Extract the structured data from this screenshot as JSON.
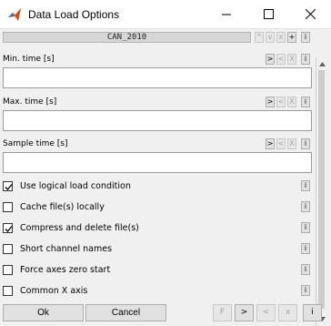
{
  "window": {
    "title": "Data Load Options",
    "controls": {
      "minimize": "minimize",
      "maximize": "maximize",
      "close": "close"
    }
  },
  "header": {
    "name": "CAN_2010",
    "buttons": [
      "^",
      "v",
      "x",
      "+",
      "i"
    ]
  },
  "fields": [
    {
      "label": "Min. time [s]",
      "value": "",
      "buttons": [
        ">",
        "<",
        "X",
        "i"
      ]
    },
    {
      "label": "Max. time [s]",
      "value": "",
      "buttons": [
        ">",
        "<",
        "X",
        "i"
      ]
    },
    {
      "label": "Sample time [s]",
      "value": "",
      "buttons": [
        ">",
        "<",
        "X",
        "i"
      ]
    }
  ],
  "checkboxes": [
    {
      "label": "Use logical load condition",
      "checked": true,
      "info": "i"
    },
    {
      "label": "Cache file(s) locally",
      "checked": false,
      "info": "i"
    },
    {
      "label": "Compress and delete file(s)",
      "checked": true,
      "info": "i"
    },
    {
      "label": "Short channel names",
      "checked": false,
      "info": "i"
    },
    {
      "label": "Force axes zero start",
      "checked": false,
      "info": "i"
    },
    {
      "label": "Common X axis",
      "checked": false,
      "info": "i"
    }
  ],
  "footer": {
    "ok_label": "Ok",
    "cancel_label": "Cancel",
    "nav_buttons": [
      "F",
      ">",
      "<",
      "x",
      "i"
    ]
  },
  "colors": {
    "background": "#f0f0f0",
    "icon_accent": "#e8742a"
  }
}
